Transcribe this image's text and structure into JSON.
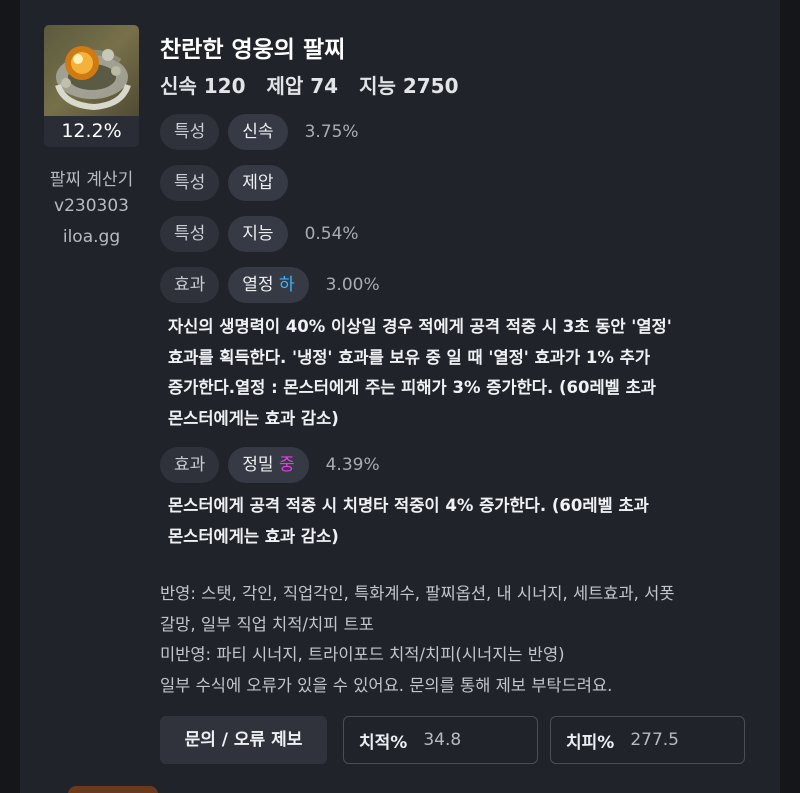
{
  "item": {
    "name": "찬란한 영웅의 팔찌",
    "stats": [
      "신속 120",
      "제압 74",
      "지능 2750"
    ],
    "rate": "12.2%"
  },
  "sidebar": {
    "app_name": "팔찌 계산기",
    "version": "v230303",
    "site": "iloa.gg"
  },
  "options": [
    {
      "type": "특성",
      "name": "신속",
      "grade": "",
      "value": "3.75%"
    },
    {
      "type": "특성",
      "name": "제압",
      "grade": "",
      "value": ""
    },
    {
      "type": "특성",
      "name": "지능",
      "grade": "",
      "value": "0.54%"
    },
    {
      "type": "효과",
      "name": "열정",
      "grade": "하",
      "grade_color": "#3cb5ff",
      "value": "3.00%",
      "description": [
        "자신의 생명력이 40% 이상일 경우 적에게 공격 적중 시 3초 동안 '열정'",
        "효과를 획득한다. '냉정' 효과를 보유 중 일 때 '열정' 효과가 1% 추가",
        "증가한다.열정 : 몬스터에게 주는 피해가 3% 증가한다. (60레벨 초과",
        "몬스터에게는 효과 감소)"
      ]
    },
    {
      "type": "효과",
      "name": "정밀",
      "grade": "중",
      "grade_color": "#e040e0",
      "value": "4.39%",
      "description": [
        "몬스터에게 공격 적중 시 치명타 적중이 4% 증가한다. (60레벨 초과",
        "몬스터에게는 효과 감소)"
      ]
    }
  ],
  "info": [
    "반영: 스탯, 각인, 직업각인, 특화계수, 팔찌옵션, 내 시너지, 세트효과, 서폿",
    "갈망, 일부 직업 치적/치피 트포",
    "미반영: 파티 시너지, 트라이포드 치적/치피(시너지는 반영)",
    "일부 수식에 오류가 있을 수 있어요. 문의를 통해 제보 부탁드려요."
  ],
  "actions": {
    "report_button": "문의 / 오류 제보",
    "crit_rate_label": "치적%",
    "crit_rate_value": "34.8",
    "crit_dmg_label": "치피%",
    "crit_dmg_value": "277.5"
  }
}
